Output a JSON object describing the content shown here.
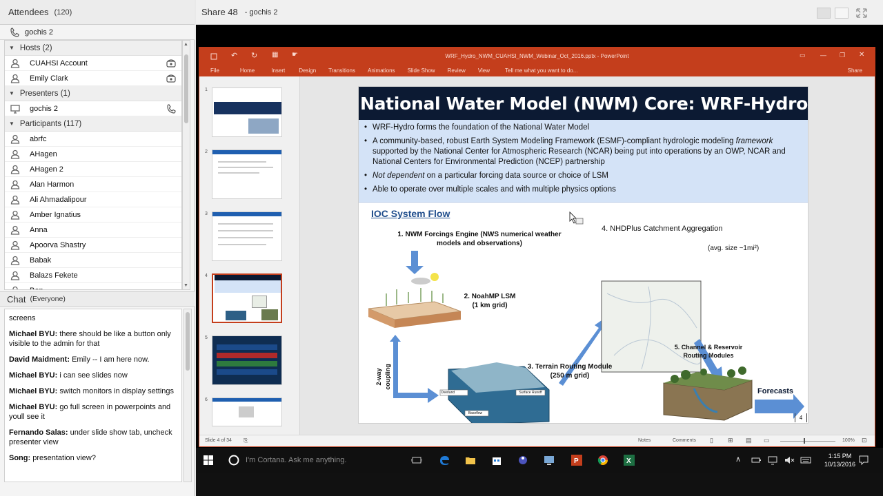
{
  "attendees": {
    "title": "Attendees",
    "count": "(120)",
    "me": "gochis 2",
    "hosts_label": "Hosts (2)",
    "hosts": [
      "CUAHSI Account",
      "Emily Clark"
    ],
    "presenters_label": "Presenters (1)",
    "presenters": [
      "gochis 2"
    ],
    "participants_label": "Participants (117)",
    "participants": [
      "abrfc",
      "AHagen",
      "AHagen 2",
      "Alan Harmon",
      "Ali Ahmadalipour",
      "Amber Ignatius",
      "Anna",
      "Apoorva Shastry",
      "Babak",
      "Balazs Fekete",
      "Ben"
    ]
  },
  "chat": {
    "title": "Chat",
    "scope": "(Everyone)",
    "messages": [
      {
        "who": "",
        "text": "screens"
      },
      {
        "who": "Michael BYU:",
        "text": " there should be like a button only visible to the admin for that"
      },
      {
        "who": "David Maidment:",
        "text": " Emily -- I am here now."
      },
      {
        "who": "Michael BYU:",
        "text": " i can see slides now"
      },
      {
        "who": "Michael BYU:",
        "text": " switch monitors in display settings"
      },
      {
        "who": "Michael BYU:",
        "text": " go full screen in powerpoints and youll see it"
      },
      {
        "who": "Fernando Salas:",
        "text": "  under slide show tab, uncheck presenter view"
      },
      {
        "who": "Song:",
        "text": " presentation view?"
      }
    ]
  },
  "share": {
    "title": "Share 48",
    "sub": "- gochis 2"
  },
  "ppt": {
    "window_title": "WRF_Hydro_NWM_CUAHSI_NWM_Webinar_Oct_2016.pptx - PowerPoint",
    "tabs": [
      "File",
      "Home",
      "Insert",
      "Design",
      "Transitions",
      "Animations",
      "Slide Show",
      "Review",
      "View"
    ],
    "tell_me": "Tell me what you want to do...",
    "share": "Share",
    "thumb_numbers": [
      "1",
      "2",
      "3",
      "4",
      "5",
      "6"
    ],
    "status_slide": "Slide 4 of 34",
    "status_notes": "Notes",
    "status_comments": "Comments",
    "zoom": "100%",
    "accent": "#c43e1c"
  },
  "slide": {
    "title": "National Water Model (NWM) Core: WRF-Hydro",
    "b1": "WRF-Hydro forms the foundation of the National Water Model",
    "b2a": "A community-based, robust Earth System Modeling Framework (ESMF)-compliant hydrologic modeling ",
    "b2em": "framework",
    "b2b": " supported by the National Center for Atmospheric Research (NCAR) being put into operations by an OWP, NCAR and National Centers for Environmental Prediction (NCEP) partnership",
    "b3em": "Not dependent",
    "b3b": " on a particular forcing data source or choice of LSM",
    "b4": "Able to operate over multiple scales and with multiple physics options",
    "ioc": "IOC System Flow",
    "l1": "1. NWM Forcings Engine (NWS numerical weather models and observations)",
    "l2": "2. NoahMP LSM (1 km grid)",
    "l3": "3. Terrain Routing Module (250 m grid)",
    "l4": "4. NHDPlus Catchment Aggregation",
    "l4s": "(avg. size ~1mi²)",
    "l5": "5. Channel & Reservoir Routing Modules",
    "forecasts": "Forecasts",
    "coupling": "2-way coupling",
    "overland": "Overland",
    "surface_runoff": "Surface Runoff",
    "baseflow": "Baseflow",
    "page": "4"
  },
  "taskbar": {
    "cortana": "I'm Cortana. Ask me anything.",
    "time": "1:15 PM",
    "date": "10/13/2016"
  }
}
